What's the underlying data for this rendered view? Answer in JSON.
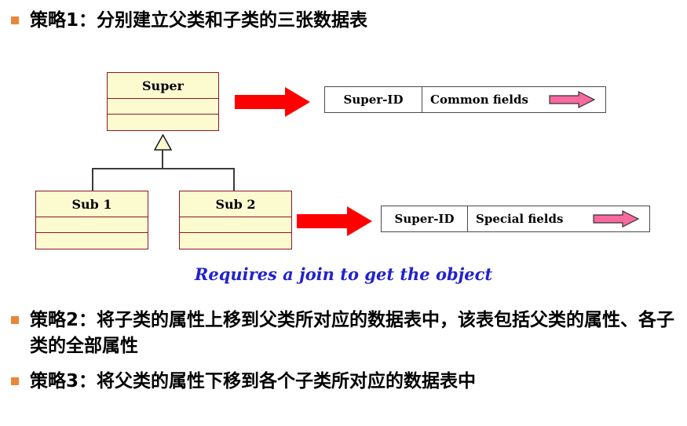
{
  "slide": {
    "bullets": [
      {
        "marker": "square-bullet",
        "text": "策略1：分别建立父类和子类的三张数据表"
      },
      {
        "marker": "square-bullet",
        "text": "策略2：将子类的属性上移到父类所对应的数据表中，该表包括父类的属性、各子类的全部属性"
      },
      {
        "marker": "square-bullet",
        "text": "策略3：将父类的属性下移到各个子类所对应的数据表中"
      }
    ],
    "caption": "Requires a join to get the object"
  },
  "diagram": {
    "type": "uml-class-inheritance",
    "classes": [
      {
        "id": "super",
        "name": "Super",
        "compartments": 2
      },
      {
        "id": "sub1",
        "name": "Sub 1",
        "compartments": 2
      },
      {
        "id": "sub2",
        "name": "Sub 2",
        "compartments": 2
      }
    ],
    "relationship": "generalization",
    "arrows": [
      {
        "id": "red-arrow-1",
        "icon": "right-arrow-icon",
        "color": "#FF0000"
      },
      {
        "id": "red-arrow-2",
        "icon": "right-arrow-icon",
        "color": "#FF0000"
      }
    ]
  },
  "tables": [
    {
      "id": "super-table",
      "id_column": "Super-ID",
      "fields_column": "Common fields",
      "arrow_icon": "pink-right-arrow-icon"
    },
    {
      "id": "sub-table",
      "id_column": "Super-ID",
      "fields_column": "Special fields",
      "arrow_icon": "pink-right-arrow-icon"
    }
  ],
  "colors": {
    "bullet_marker": "#E8873A",
    "uml_fill": "#FCFBD0",
    "uml_border": "#8C1725",
    "red_arrow": "#FF0000",
    "pink_arrow": "#F8699F",
    "caption_text": "#2222CC",
    "table_border": "#4A4A4A"
  }
}
